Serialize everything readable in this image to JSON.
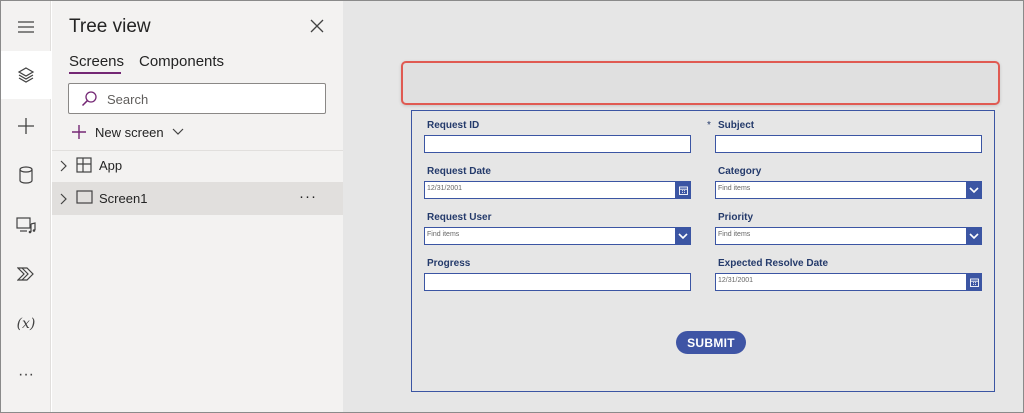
{
  "rail": {
    "items": [
      {
        "name": "menu-icon"
      },
      {
        "name": "layers-icon"
      },
      {
        "name": "plus-icon"
      },
      {
        "name": "database-icon"
      },
      {
        "name": "media-icon"
      },
      {
        "name": "power-automate-icon"
      },
      {
        "name": "variables-icon",
        "label": "(x)"
      },
      {
        "name": "more-icon",
        "label": "···"
      }
    ]
  },
  "panel": {
    "title": "Tree view",
    "tabs": [
      {
        "label": "Screens",
        "active": true
      },
      {
        "label": "Components",
        "active": false
      }
    ],
    "search": {
      "placeholder": "Search"
    },
    "new_screen_label": "New screen",
    "tree": [
      {
        "label": "App",
        "selected": false
      },
      {
        "label": "Screen1",
        "selected": true,
        "more": "···"
      }
    ]
  },
  "form": {
    "fields": [
      {
        "label": "Request ID",
        "type": "text",
        "value": ""
      },
      {
        "label": "Subject",
        "type": "text",
        "required": true,
        "required_mark": "*",
        "value": ""
      },
      {
        "label": "Request Date",
        "type": "date",
        "value": "12/31/2001"
      },
      {
        "label": "Category",
        "type": "combo",
        "value": "Find items"
      },
      {
        "label": "Request User",
        "type": "combo",
        "value": "Find items"
      },
      {
        "label": "Priority",
        "type": "combo",
        "value": "Find items"
      },
      {
        "label": "Progress",
        "type": "text",
        "value": ""
      },
      {
        "label": "Expected Resolve Date",
        "type": "date",
        "value": "12/31/2001"
      }
    ],
    "submit_label": "SUBMIT"
  },
  "colors": {
    "accent": "#742774",
    "form_border": "#3b55a3",
    "submit_bg": "#3f55a5",
    "highlight": "#e05a52"
  }
}
